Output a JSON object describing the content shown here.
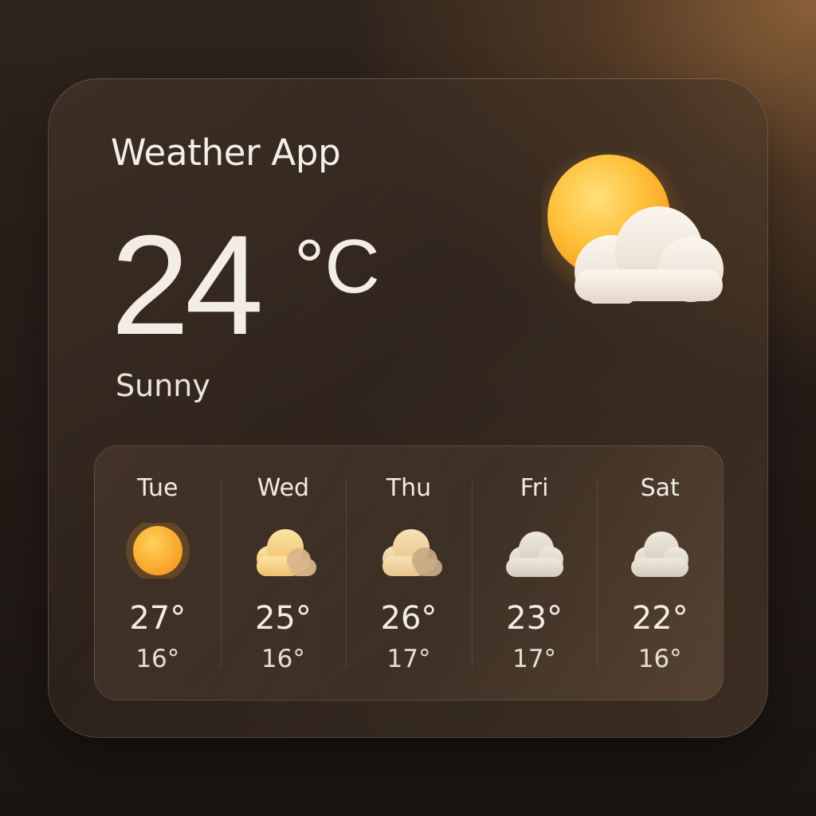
{
  "app": {
    "title": "Weather App"
  },
  "current": {
    "temperature": "24",
    "unit": "°C",
    "condition": "Sunny",
    "icon": "sun-behind-cloud-icon"
  },
  "forecast": [
    {
      "day": "Tue",
      "high": "27°",
      "low": "16°",
      "icon": "sun-icon"
    },
    {
      "day": "Wed",
      "high": "25°",
      "low": "16°",
      "icon": "partly-cloudy-icon"
    },
    {
      "day": "Thu",
      "high": "26°",
      "low": "17°",
      "icon": "partly-cloudy-icon"
    },
    {
      "day": "Fri",
      "high": "23°",
      "low": "17°",
      "icon": "cloud-icon"
    },
    {
      "day": "Sat",
      "high": "22°",
      "low": "16°",
      "icon": "cloud-icon"
    }
  ],
  "colors": {
    "sun": "#ffb52e",
    "cloud": "#eee5d8",
    "text": "#f3ede6"
  }
}
